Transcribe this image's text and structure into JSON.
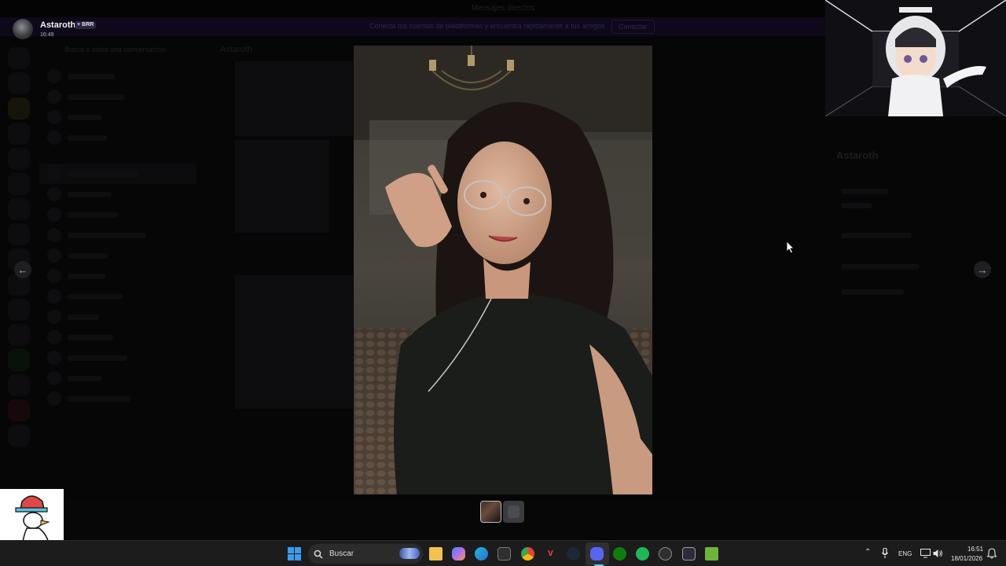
{
  "app": {
    "window_title": "Mensajes directos"
  },
  "background": {
    "banner_text": "Conecta tus cuentas de plataformas y encuentra rápidamente a tus amigos",
    "banner_button": "Conectar",
    "search_placeholder": "Busca o inicia una conversación",
    "chat_name": "Astaroth",
    "side_name": "Astaroth"
  },
  "viewer": {
    "author_name": "Astaroth",
    "author_tag": "BRR",
    "timestamp": "16:49",
    "prev_label": "←",
    "next_label": "→",
    "thumbnail_count": 2,
    "selected_thumbnail": 1
  },
  "taskbar": {
    "search_label": "Buscar",
    "language": "ENG",
    "time": "16:51",
    "date": "18/01/2026"
  },
  "colors": {
    "accent": "#5865f2",
    "taskbar": "#1c1c1c",
    "start": "#3a9bf0"
  },
  "icons": [
    "windows-start-icon",
    "search-icon",
    "file-explorer-icon",
    "copilot-icon",
    "edge-icon",
    "store-icon",
    "chrome-icon",
    "valorant-icon",
    "steam-icon",
    "discord-icon",
    "xbox-icon",
    "spotify-icon",
    "obs-icon",
    "app-icon",
    "minecraft-icon",
    "chevron-up-icon",
    "microphone-icon",
    "network-icon",
    "volume-icon",
    "notification-icon"
  ]
}
